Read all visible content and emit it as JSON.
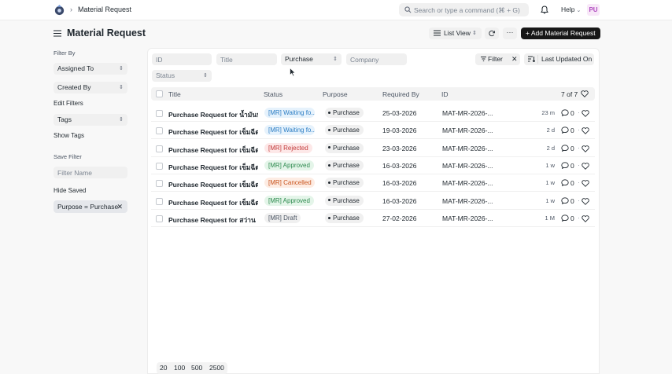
{
  "navbar": {
    "breadcrumb": "Material Request",
    "search_placeholder": "Search or type a command (⌘ + G)",
    "help_label": "Help",
    "avatar_initials": "PU"
  },
  "page": {
    "title": "Material Request",
    "list_view_label": "List View",
    "more_label": "···",
    "add_label": "+ Add Material Request"
  },
  "sidebar": {
    "filter_by": "Filter By",
    "assigned_to": "Assigned To",
    "created_by": "Created By",
    "edit_filters": "Edit Filters",
    "tags": "Tags",
    "show_tags": "Show Tags",
    "save_filter": "Save Filter",
    "filter_name_placeholder": "Filter Name",
    "hide_saved": "Hide Saved",
    "saved_chip": "Purpose = Purchase"
  },
  "filters": {
    "id_placeholder": "ID",
    "title_placeholder": "Title",
    "purpose_value": "Purchase",
    "company_placeholder": "Company",
    "status_placeholder": "Status",
    "filter_label": "Filter",
    "sort_label": "Last Updated On"
  },
  "table": {
    "headers": {
      "title": "Title",
      "status": "Status",
      "purpose": "Purpose",
      "required_by": "Required By",
      "id": "ID"
    },
    "count": "7 of 7",
    "rows": [
      {
        "title": "Purchase Request for น้ำมันหอ",
        "status": "[MR] Waiting fo...",
        "status_color": "blue",
        "purpose": "Purchase",
        "required_by": "25-03-2026",
        "id": "MAT-MR-2026-...",
        "ago": "23 m",
        "comments": "0"
      },
      {
        "title": "Purchase Request for เข็มฉีดยา",
        "status": "[MR] Waiting fo...",
        "status_color": "blue",
        "purpose": "Purchase",
        "required_by": "19-03-2026",
        "id": "MAT-MR-2026-...",
        "ago": "2 d",
        "comments": "0"
      },
      {
        "title": "Purchase Request for เข็มฉีดยา",
        "status": "[MR] Rejected",
        "status_color": "red",
        "purpose": "Purchase",
        "required_by": "23-03-2026",
        "id": "MAT-MR-2026-...",
        "ago": "2 d",
        "comments": "0"
      },
      {
        "title": "Purchase Request for เข็มฉีดยา",
        "status": "[MR] Approved",
        "status_color": "green",
        "purpose": "Purchase",
        "required_by": "16-03-2026",
        "id": "MAT-MR-2026-...",
        "ago": "1 w",
        "comments": "0"
      },
      {
        "title": "Purchase Request for เข็มฉีดยา",
        "status": "[MR] Cancelled",
        "status_color": "orange",
        "purpose": "Purchase",
        "required_by": "16-03-2026",
        "id": "MAT-MR-2026-...",
        "ago": "1 w",
        "comments": "0"
      },
      {
        "title": "Purchase Request for เข็มฉีดยา",
        "status": "[MR] Approved",
        "status_color": "green",
        "purpose": "Purchase",
        "required_by": "16-03-2026",
        "id": "MAT-MR-2026-...",
        "ago": "1 w",
        "comments": "0"
      },
      {
        "title": "Purchase Request for สว่าน",
        "status": "[MR] Draft",
        "status_color": "gray",
        "purpose": "Purchase",
        "required_by": "27-02-2026",
        "id": "MAT-MR-2026-...",
        "ago": "1 M",
        "comments": "0"
      }
    ]
  },
  "paging": [
    "20",
    "100",
    "500",
    "2500"
  ],
  "colors": {
    "primary_button": "#171717",
    "status_blue": "#2d7ec4",
    "status_red": "#c23a3a",
    "status_green": "#2d8a4e",
    "status_orange": "#c9551e"
  }
}
